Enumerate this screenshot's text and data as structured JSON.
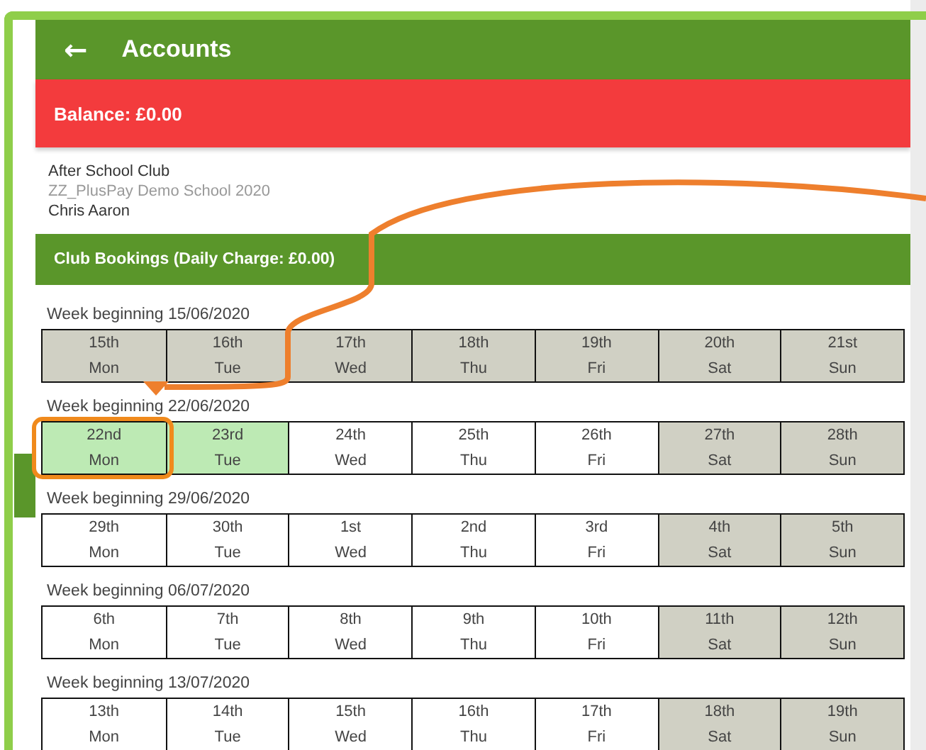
{
  "header": {
    "back_icon": "←",
    "title": "Accounts"
  },
  "balance": "Balance: £0.00",
  "club": {
    "name": "After School Club",
    "school": "ZZ_PlusPay Demo School 2020",
    "child": "Chris Aaron"
  },
  "bookings_title": "Club Bookings (Daily Charge: £0.00)",
  "weeks": [
    {
      "label": "Week beginning 15/06/2020",
      "days": [
        {
          "date": "15th",
          "day": "Mon",
          "kind": "closed"
        },
        {
          "date": "16th",
          "day": "Tue",
          "kind": "closed"
        },
        {
          "date": "17th",
          "day": "Wed",
          "kind": "closed"
        },
        {
          "date": "18th",
          "day": "Thu",
          "kind": "closed"
        },
        {
          "date": "19th",
          "day": "Fri",
          "kind": "closed"
        },
        {
          "date": "20th",
          "day": "Sat",
          "kind": "closed"
        },
        {
          "date": "21st",
          "day": "Sun",
          "kind": "closed"
        }
      ]
    },
    {
      "label": "Week beginning 22/06/2020",
      "days": [
        {
          "date": "22nd",
          "day": "Mon",
          "kind": "booked"
        },
        {
          "date": "23rd",
          "day": "Tue",
          "kind": "booked"
        },
        {
          "date": "24th",
          "day": "Wed",
          "kind": "open"
        },
        {
          "date": "25th",
          "day": "Thu",
          "kind": "open"
        },
        {
          "date": "26th",
          "day": "Fri",
          "kind": "open"
        },
        {
          "date": "27th",
          "day": "Sat",
          "kind": "closed"
        },
        {
          "date": "28th",
          "day": "Sun",
          "kind": "closed"
        }
      ]
    },
    {
      "label": "Week beginning 29/06/2020",
      "days": [
        {
          "date": "29th",
          "day": "Mon",
          "kind": "open"
        },
        {
          "date": "30th",
          "day": "Tue",
          "kind": "open"
        },
        {
          "date": "1st",
          "day": "Wed",
          "kind": "open"
        },
        {
          "date": "2nd",
          "day": "Thu",
          "kind": "open"
        },
        {
          "date": "3rd",
          "day": "Fri",
          "kind": "open"
        },
        {
          "date": "4th",
          "day": "Sat",
          "kind": "closed"
        },
        {
          "date": "5th",
          "day": "Sun",
          "kind": "closed"
        }
      ]
    },
    {
      "label": "Week beginning 06/07/2020",
      "days": [
        {
          "date": "6th",
          "day": "Mon",
          "kind": "open"
        },
        {
          "date": "7th",
          "day": "Tue",
          "kind": "open"
        },
        {
          "date": "8th",
          "day": "Wed",
          "kind": "open"
        },
        {
          "date": "9th",
          "day": "Thu",
          "kind": "open"
        },
        {
          "date": "10th",
          "day": "Fri",
          "kind": "open"
        },
        {
          "date": "11th",
          "day": "Sat",
          "kind": "closed"
        },
        {
          "date": "12th",
          "day": "Sun",
          "kind": "closed"
        }
      ]
    },
    {
      "label": "Week beginning 13/07/2020",
      "days": [
        {
          "date": "13th",
          "day": "Mon",
          "kind": "open"
        },
        {
          "date": "14th",
          "day": "Tue",
          "kind": "open"
        },
        {
          "date": "15th",
          "day": "Wed",
          "kind": "open"
        },
        {
          "date": "16th",
          "day": "Thu",
          "kind": "open"
        },
        {
          "date": "17th",
          "day": "Fri",
          "kind": "open"
        },
        {
          "date": "18th",
          "day": "Sat",
          "kind": "closed"
        },
        {
          "date": "19th",
          "day": "Sun",
          "kind": "closed"
        }
      ]
    }
  ]
}
